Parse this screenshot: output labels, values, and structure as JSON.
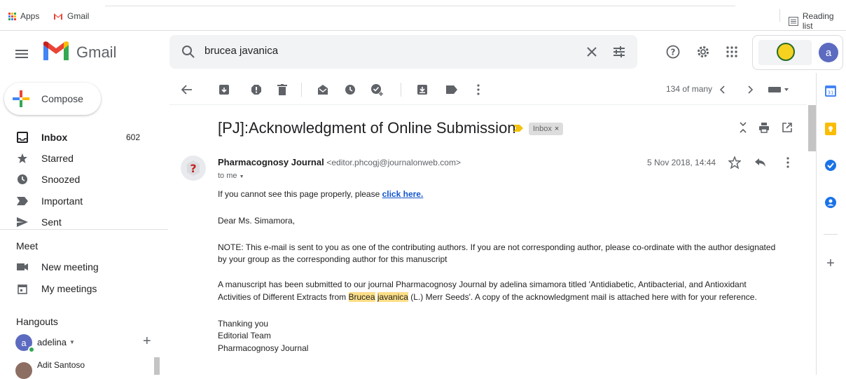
{
  "bookmarks": {
    "apps_label": "Apps",
    "gmail_label": "Gmail",
    "reading_list_label": "Reading list"
  },
  "header": {
    "logo_text": "Gmail",
    "search_value": "brucea javanica",
    "account_initial": "a"
  },
  "sidebar": {
    "compose_label": "Compose",
    "items": [
      {
        "label": "Inbox",
        "count": "602",
        "icon": "inbox-icon"
      },
      {
        "label": "Starred",
        "count": "",
        "icon": "star-icon"
      },
      {
        "label": "Snoozed",
        "count": "",
        "icon": "clock-icon"
      },
      {
        "label": "Important",
        "count": "",
        "icon": "important-icon"
      },
      {
        "label": "Sent",
        "count": "",
        "icon": "send-icon"
      }
    ],
    "meet_title": "Meet",
    "meet_items": [
      {
        "label": "New meeting",
        "icon": "video-icon"
      },
      {
        "label": "My meetings",
        "icon": "calendar-icon"
      }
    ],
    "hangouts_title": "Hangouts",
    "hangouts_user": "adelina",
    "hangouts_user_initial": "a",
    "hangouts_contact": "Adit Santoso"
  },
  "toolbar": {
    "pager_text": "134 of many"
  },
  "message": {
    "subject": "[PJ]:Acknowledgment of Online Submission",
    "label_chip": "Inbox",
    "sender_name": "Pharmacognosy Journal",
    "sender_email": "<editor.phcogj@journalonweb.com>",
    "to_line": "to me",
    "date": "5 Nov 2018, 14:44",
    "line1_prefix": "If you cannot see this page properly, please ",
    "line1_link": "click here.",
    "greeting": "Dear Ms. Simamora,",
    "note_line1": "NOTE: This e-mail is sent to you as one of the contributing authors. If you are not corresponding author, please co-ordinate with the author designated",
    "note_line2": "by your group as the corresponding author for this manuscript",
    "para_line1": "A manuscript has been submitted to our journal Pharmacognosy Journal by adelina simamora titled 'Antidiabetic, Antibacterial, and Antioxidant",
    "para_line2_prefix": "Activities of Different Extracts from ",
    "para_hl1": "Brucea",
    "para_hl2": "javanica",
    "para_line2_suffix": " (L.) Merr Seeds'. A copy of the acknowledgment mail is attached here with for your reference.",
    "sign1": "Thanking you",
    "sign2": "Editorial Team",
    "sign3": "Pharmacognosy Journal"
  },
  "colors": {
    "gmail_red": "#EA4335",
    "highlight": "#FDDF88",
    "link": "#1155CC",
    "avatar": "#5C6BC0"
  }
}
